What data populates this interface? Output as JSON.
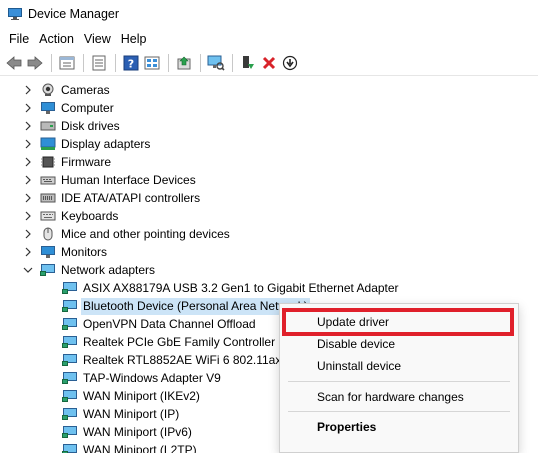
{
  "window": {
    "title": "Device Manager"
  },
  "menubar": {
    "items": [
      "File",
      "Action",
      "View",
      "Help"
    ]
  },
  "toolbar": {
    "buttons": [
      "back-arrow-icon",
      "forward-arrow-icon",
      "properties-icon",
      "details-icon",
      "help-icon",
      "view-icon",
      "update-driver-icon",
      "scan-hardware-icon",
      "enable-device-icon",
      "uninstall-icon",
      "download-icon"
    ]
  },
  "tree": {
    "categories": [
      {
        "label": "Cameras",
        "icon": "camera-icon"
      },
      {
        "label": "Computer",
        "icon": "computer-icon"
      },
      {
        "label": "Disk drives",
        "icon": "disk-drive-icon"
      },
      {
        "label": "Display adapters",
        "icon": "display-adapter-icon"
      },
      {
        "label": "Firmware",
        "icon": "firmware-icon"
      },
      {
        "label": "Human Interface Devices",
        "icon": "hid-icon"
      },
      {
        "label": "IDE ATA/ATAPI controllers",
        "icon": "ide-controller-icon"
      },
      {
        "label": "Keyboards",
        "icon": "keyboard-icon"
      },
      {
        "label": "Mice and other pointing devices",
        "icon": "mouse-icon"
      },
      {
        "label": "Monitors",
        "icon": "monitor-icon"
      },
      {
        "label": "Network adapters",
        "icon": "network-adapter-icon"
      }
    ],
    "network_children": [
      "ASIX AX88179A USB 3.2 Gen1 to Gigabit Ethernet Adapter",
      "Bluetooth Device (Personal Area Network)",
      "OpenVPN Data Channel Offload",
      "Realtek PCIe GbE Family Controller",
      "Realtek RTL8852AE WiFi 6 802.11ax PC",
      "TAP-Windows Adapter V9",
      "WAN Miniport (IKEv2)",
      "WAN Miniport (IP)",
      "WAN Miniport (IPv6)",
      "WAN Miniport (L2TP)"
    ],
    "selected_index": 1
  },
  "context_menu": {
    "update_driver": "Update driver",
    "disable_device": "Disable device",
    "uninstall_device": "Uninstall device",
    "scan_hardware": "Scan for hardware changes",
    "properties": "Properties",
    "highlight_color": "#e0202b"
  },
  "colors": {
    "selection": "#cce4f7",
    "accent": "#2f8fd6"
  }
}
